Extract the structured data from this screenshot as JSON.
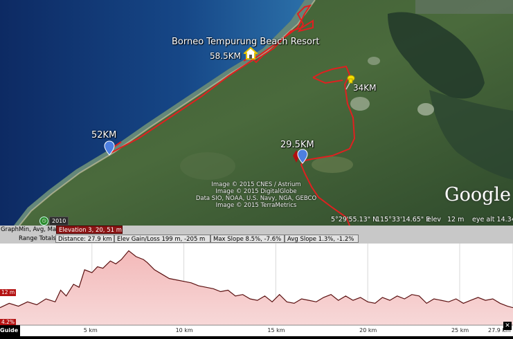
{
  "map": {
    "place_name": "Borneo Tempurung Beach Resort",
    "markers": [
      {
        "label": "58.5KM",
        "icon": "house-icon"
      },
      {
        "label": "34KM",
        "icon": "yellow-pushpin-icon"
      },
      {
        "label": "52KM",
        "icon": "blue-placemark-icon"
      },
      {
        "label": "29.5KM",
        "icon": "blue-placemark-icon"
      }
    ],
    "credits": [
      "Image © 2015 CNES / Astrium",
      "Image © 2015 DigitalGlobe",
      "Data SIO, NOAA, U.S. Navy, NGA, GEBCO",
      "Image © 2015 TerraMetrics"
    ],
    "logo": "Google ea",
    "year": "2010",
    "status": {
      "lat": "5°29'55.13\" N",
      "lon": "115°33'14.65\" E",
      "elev_label": "elev",
      "elev_value": "12 m",
      "eye_alt": "eye alt  14.34"
    },
    "route_color": "#e02020"
  },
  "profile": {
    "row1": {
      "graph_label": "Graph",
      "stats_label": "Min, Avg, Max",
      "elevation": "Elevation  3, 20, 51 m"
    },
    "row2": {
      "range_totals": "Range Totals",
      "distance": "Distance: 27.9 km",
      "elev_gain_loss": "Elev Gain/Loss  199 m, -205 m",
      "max_slope": "Max Slope  8.5%, -7.6%",
      "avg_slope": "Avg Slope  1.3%, -1.2%"
    },
    "left_tag_elev": "12 m",
    "left_tag_slope": "4.2%",
    "guide_label": "Guide",
    "ticks": [
      "5 km",
      "10 km",
      "15 km",
      "20 km",
      "25 km",
      "27.9 km"
    ]
  },
  "chart_data": {
    "type": "area",
    "xlabel": "",
    "ylabel": "",
    "xlim": [
      0,
      27.9
    ],
    "ylim": [
      0,
      55
    ],
    "x": [
      0,
      0.5,
      1,
      1.5,
      2,
      2.5,
      3,
      3.3,
      3.6,
      4,
      4.3,
      4.6,
      5,
      5.3,
      5.6,
      6,
      6.3,
      6.6,
      7,
      7.4,
      7.8,
      8,
      8.4,
      8.8,
      9.2,
      9.6,
      10,
      10.4,
      10.8,
      11.2,
      11.6,
      12,
      12.4,
      12.8,
      13.2,
      13.6,
      14,
      14.4,
      14.8,
      15.2,
      15.6,
      16,
      16.4,
      16.8,
      17.2,
      17.6,
      18,
      18.4,
      18.8,
      19.2,
      19.6,
      20,
      20.4,
      20.8,
      21.2,
      21.6,
      22,
      22.4,
      22.8,
      23.2,
      23.6,
      24,
      24.4,
      24.8,
      25.2,
      25.6,
      26,
      26.4,
      26.8,
      27.2,
      27.6,
      27.9
    ],
    "values": [
      12,
      15,
      13,
      16,
      14,
      18,
      16,
      24,
      20,
      28,
      26,
      38,
      36,
      40,
      39,
      44,
      42,
      45,
      51,
      47,
      45,
      43,
      38,
      35,
      32,
      31,
      30,
      29,
      27,
      26,
      25,
      23,
      24,
      20,
      21,
      18,
      17,
      20,
      16,
      21,
      16,
      15,
      18,
      17,
      16,
      19,
      21,
      17,
      20,
      17,
      19,
      16,
      15,
      19,
      17,
      20,
      18,
      21,
      20,
      15,
      18,
      17,
      16,
      18,
      15,
      17,
      19,
      17,
      18,
      15,
      13,
      12
    ]
  }
}
